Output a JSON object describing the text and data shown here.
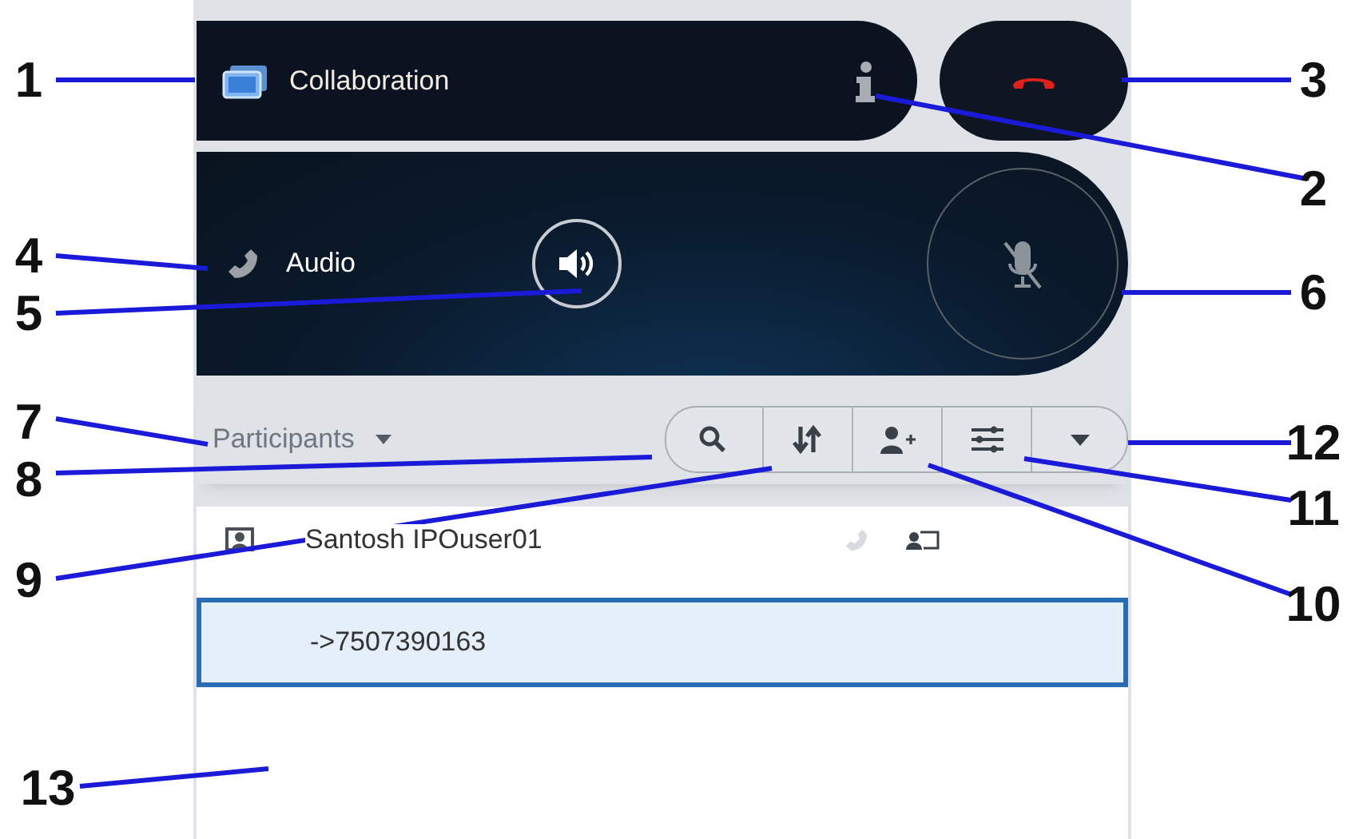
{
  "panel": {
    "title": "Collaboration",
    "audio": {
      "label": "Audio",
      "mic_muted": true
    },
    "participants": {
      "label": "Participants"
    },
    "rows": [
      {
        "kind": "participant",
        "name": "Santosh IPOuser01",
        "selected": false
      },
      {
        "kind": "number",
        "name": "->7507390163",
        "selected": true
      }
    ]
  },
  "callouts": [
    "1",
    "4",
    "5",
    "7",
    "8",
    "9",
    "13",
    "3",
    "2",
    "6",
    "12",
    "11",
    "10"
  ]
}
